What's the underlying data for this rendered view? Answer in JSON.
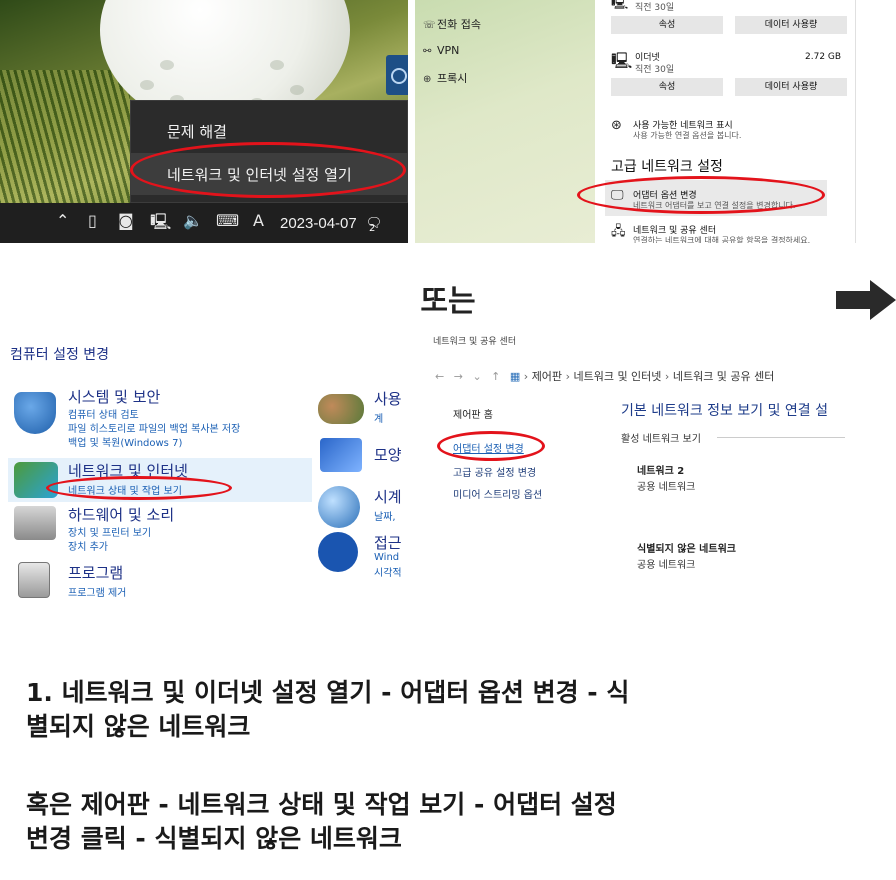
{
  "panel_taskbar": {
    "menu_items": [
      "문제 해결",
      "네트워크 및 인터넷 설정 열기"
    ],
    "taskbar_date": "2023-04-07",
    "taskbar_lang": "A",
    "notification_count": "2"
  },
  "panel_settings": {
    "sidebar_items": [
      {
        "label": "전화 접속",
        "icon": "dialup-icon"
      },
      {
        "label": "VPN",
        "icon": "vpn-icon"
      },
      {
        "label": "프록시",
        "icon": "globe-icon"
      }
    ],
    "top_sub": "직전 30일",
    "properties_label": "속성",
    "data_usage_label": "데이터 사용량",
    "ethernet_name": "이더넷",
    "ethernet_sub": "직전 30일",
    "ethernet_value": "2.72 GB",
    "show_networks_title": "사용 가능한 네트워크 표시",
    "show_networks_desc": "사용 가능한 연결 옵션을 봅니다.",
    "advanced_header": "고급 네트워크 설정",
    "adapter_title": "어댑터 옵션 변경",
    "adapter_desc": "네트워크 어댑터를 보고 연결 설정을 변경합니다.",
    "sharing_title": "네트워크 및 공유 센터",
    "sharing_desc": "연결하는 네트워크에 대해 공유할 항목을 결정하세요."
  },
  "middle": {
    "or_text": "또는"
  },
  "panel_control": {
    "title": "컴퓨터 설정 변경",
    "categories": [
      {
        "heading": "시스템 및 보안",
        "links": [
          "컴퓨터 상태 검토",
          "파일 히스토리로 파일의 백업 복사본 저장",
          "백업 및 복원(Windows 7)"
        ]
      },
      {
        "heading": "네트워크 및 인터넷",
        "links": [
          "네트워크 상태 및 작업 보기"
        ]
      },
      {
        "heading": "하드웨어 및 소리",
        "links": [
          "장치 및 프린터 보기",
          "장치 추가"
        ]
      },
      {
        "heading": "프로그램",
        "links": [
          "프로그램 제거"
        ]
      }
    ],
    "right_col": {
      "h1": "사용",
      "h1_link": "계",
      "h2": "모양",
      "h3": "시계",
      "h3_link": "날짜,",
      "h4": "접근",
      "h4_link1": "Wind",
      "h4_link2": "시각적"
    }
  },
  "panel_sharing": {
    "window_title": "네트워크 및 공유 센터",
    "breadcrumb": [
      "제어판",
      "네트워크 및 인터넷",
      "네트워크 및 공유 센터"
    ],
    "left_links": [
      "제어판 홈",
      "어댑터 설정 변경",
      "고급 공유 설정 변경",
      "미디어 스트리밍 옵션"
    ],
    "heading": "기본 네트워크 정보 보기 및 연결 설",
    "active_label": "활성 네트워크 보기",
    "networks": [
      {
        "name": "네트워크 2",
        "type": "공용 네트워크"
      },
      {
        "name": "식별되지 않은 네트워크",
        "type": "공용 네트워크"
      }
    ]
  },
  "instructions": {
    "line1a": "1. 네트워크 및 이더넷 설정 열기 - 어댑터 옵션 변경 - 식",
    "line1b": "별되지 않은 네트워크",
    "line2a": "혹은 제어판 - 네트워크 상태 및 작업 보기 - 어댑터 설정",
    "line2b": "변경 클릭 - 식별되지 않은 네트워크"
  },
  "colors": {
    "highlight_oval": "#e3131b",
    "control_panel_heading": "#1e3287",
    "link_blue": "#1a5fb4"
  }
}
